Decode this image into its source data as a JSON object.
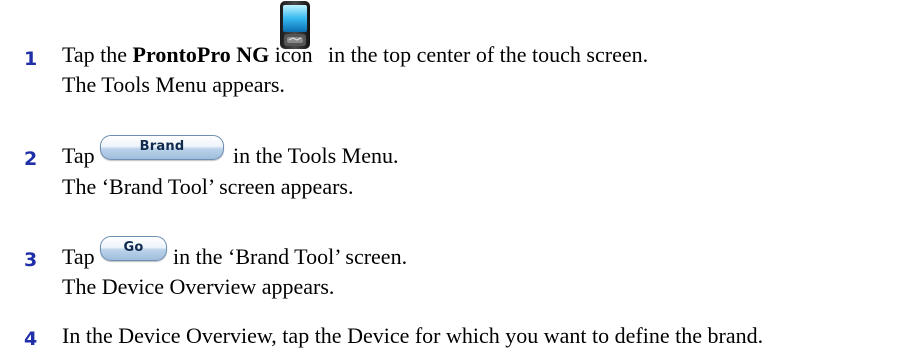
{
  "steps": [
    {
      "number": "1",
      "line1_pre": "Tap the",
      "line1_bold": "ProntoPro NG",
      "line1_mid": "icon",
      "line1_post": "in the top center of the touch screen.",
      "line2": "The Tools Menu appears.",
      "icon": "pronto-device-icon"
    },
    {
      "number": "2",
      "line1_pre": "Tap",
      "button_label": "Brand",
      "line1_post": "in the Tools Menu.",
      "line2": "The ‘Brand Tool’ screen appears."
    },
    {
      "number": "3",
      "line1_pre": "Tap",
      "button_label": "Go",
      "line1_post": "in the ‘Brand Tool’ screen.",
      "line2": "The Device Overview appears."
    },
    {
      "number": "4",
      "line1": "In the Device Overview, tap the Device for which you want to define the brand."
    }
  ],
  "colors": {
    "step_number": "#1f2fa8",
    "button_text": "#0f2a4d"
  }
}
